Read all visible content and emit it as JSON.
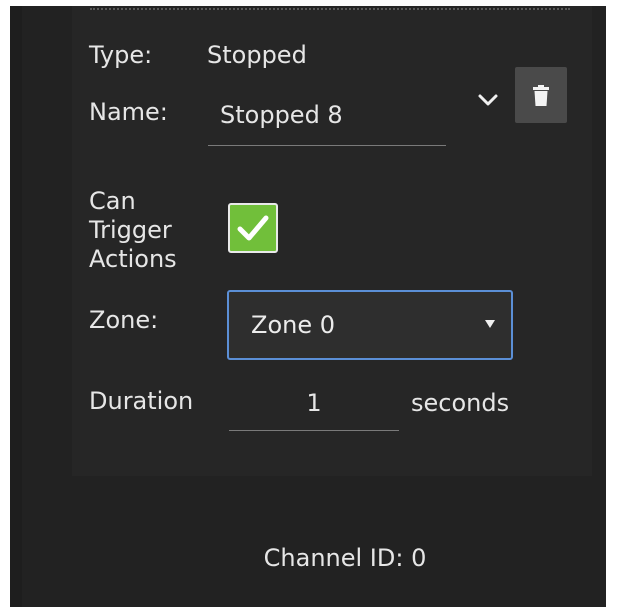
{
  "form": {
    "type_label": "Type:",
    "type_value": "Stopped",
    "name_label": "Name:",
    "name_value": "Stopped 8",
    "can_trigger_line1": "Can",
    "can_trigger_line2": "Trigger",
    "can_trigger_line3": "Actions",
    "can_trigger_checked": true,
    "zone_label": "Zone:",
    "zone_value": "Zone 0",
    "duration_label": "Duration",
    "duration_value": "1",
    "duration_unit": "seconds"
  },
  "footer": {
    "channel_id": "Channel ID: 0"
  },
  "icons": {
    "expand": "chevron-down-icon",
    "delete": "trash-icon",
    "check": "checkmark-icon",
    "dropdown": "caret-down-icon"
  },
  "colors": {
    "panel_bg": "#222222",
    "checkbox_green": "#71bf3a",
    "select_border": "#5b8fd6",
    "trash_button_bg": "#4a4a4a"
  }
}
